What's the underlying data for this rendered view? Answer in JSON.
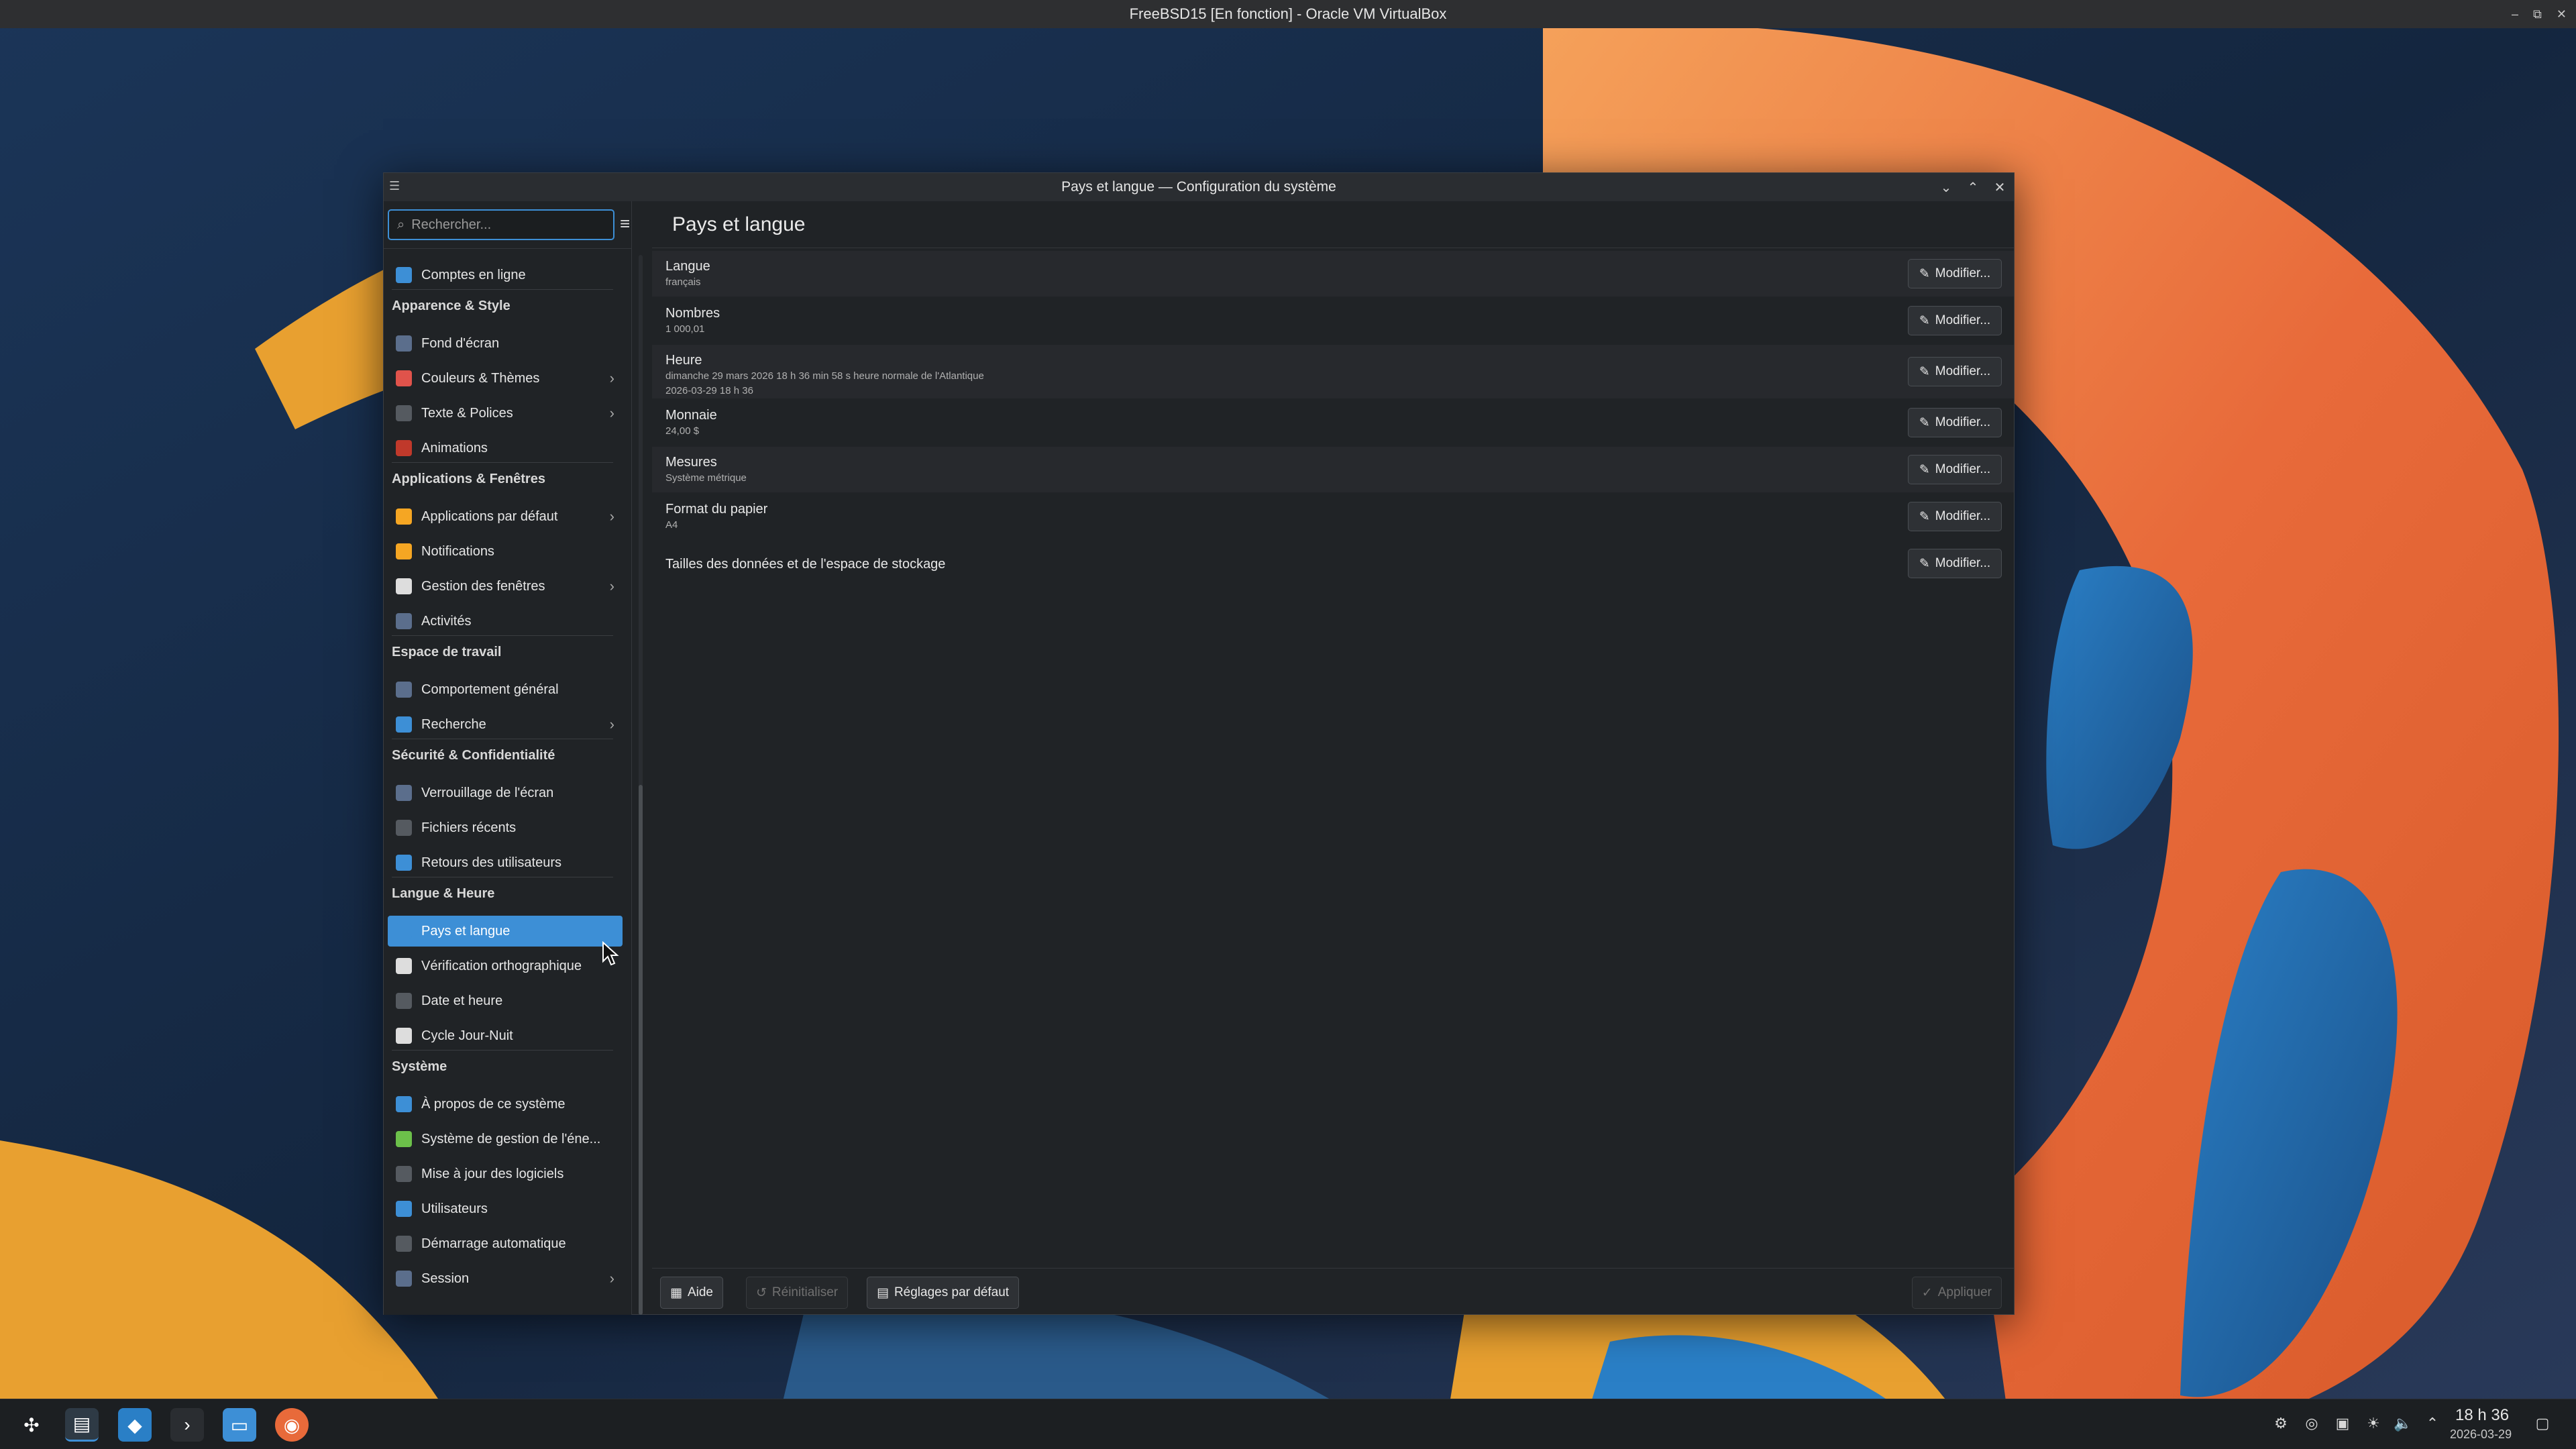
{
  "host_title": "FreeBSD15 [En fonction] - Oracle VM VirtualBox",
  "window": {
    "title": "Pays et langue — Configuration du système"
  },
  "search": {
    "placeholder": "Rechercher..."
  },
  "sidebar": {
    "items": [
      {
        "label": "Comptes en ligne",
        "icon": "globe-icon",
        "color": "#3d8fd6"
      },
      {
        "header": "Apparence & Style"
      },
      {
        "label": "Fond d'écran",
        "icon": "wallpaper-icon",
        "color": "#5b6e8c"
      },
      {
        "label": "Couleurs & Thèmes",
        "icon": "palette-icon",
        "color": "#e0534b",
        "chevron": true
      },
      {
        "label": "Texte & Polices",
        "icon": "font-icon",
        "color": "#555a60",
        "chevron": true
      },
      {
        "label": "Animations",
        "icon": "animation-icon",
        "color": "#c0392b"
      },
      {
        "header": "Applications & Fenêtres"
      },
      {
        "label": "Applications par défaut",
        "icon": "star-icon",
        "color": "#f5a623",
        "chevron": true
      },
      {
        "label": "Notifications",
        "icon": "bell-icon",
        "color": "#f5a623"
      },
      {
        "label": "Gestion des fenêtres",
        "icon": "window-icon",
        "color": "#dddddd",
        "chevron": true
      },
      {
        "label": "Activités",
        "icon": "activities-icon",
        "color": "#5b6e8c"
      },
      {
        "header": "Espace de travail"
      },
      {
        "label": "Comportement général",
        "icon": "behavior-icon",
        "color": "#5b6e8c"
      },
      {
        "label": "Recherche",
        "icon": "search-icon",
        "color": "#3d8fd6",
        "chevron": true
      },
      {
        "header": "Sécurité & Confidentialité"
      },
      {
        "label": "Verrouillage de l'écran",
        "icon": "lock-screen-icon",
        "color": "#5b6e8c"
      },
      {
        "label": "Fichiers récents",
        "icon": "recent-icon",
        "color": "#555a60"
      },
      {
        "label": "Retours des utilisateurs",
        "icon": "feedback-icon",
        "color": "#3d8fd6"
      },
      {
        "header": "Langue & Heure"
      },
      {
        "label": "Pays et langue",
        "icon": "flag-icon",
        "color": "#3d8fd6",
        "active": true
      },
      {
        "label": "Vérification orthographique",
        "icon": "spellcheck-icon",
        "color": "#dddddd"
      },
      {
        "label": "Date et heure",
        "icon": "clock-icon",
        "color": "#555a60"
      },
      {
        "label": "Cycle Jour-Nuit",
        "icon": "day-night-icon",
        "color": "#dddddd"
      },
      {
        "header": "Système"
      },
      {
        "label": "À propos de ce système",
        "icon": "info-icon",
        "color": "#3d8fd6"
      },
      {
        "label": "Système de gestion de l'éne...",
        "icon": "power-icon",
        "color": "#6cc04a"
      },
      {
        "label": "Mise à jour des logiciels",
        "icon": "update-icon",
        "color": "#555a60"
      },
      {
        "label": "Utilisateurs",
        "icon": "users-icon",
        "color": "#3d8fd6"
      },
      {
        "label": "Démarrage automatique",
        "icon": "autostart-icon",
        "color": "#555a60"
      },
      {
        "label": "Session",
        "icon": "session-icon",
        "color": "#5b6e8c",
        "chevron": true
      }
    ]
  },
  "main": {
    "title": "Pays et langue",
    "rows": [
      {
        "label": "Langue",
        "sub": [
          "français"
        ],
        "button": "Modifier..."
      },
      {
        "label": "Nombres",
        "sub": [
          "1 000,01"
        ],
        "button": "Modifier..."
      },
      {
        "label": "Heure",
        "sub": [
          "dimanche 29 mars 2026 18 h 36 min 58 s heure normale de l'Atlantique",
          "2026-03-29 18 h 36"
        ],
        "button": "Modifier..."
      },
      {
        "label": "Monnaie",
        "sub": [
          "24,00 $"
        ],
        "button": "Modifier..."
      },
      {
        "label": "Mesures",
        "sub": [
          "Système métrique"
        ],
        "button": "Modifier..."
      },
      {
        "label": "Format du papier",
        "sub": [
          "A4"
        ],
        "button": "Modifier..."
      },
      {
        "label": "Tailles des données et de l'espace de stockage",
        "sub": [],
        "button": "Modifier..."
      }
    ]
  },
  "footer": {
    "help": "Aide",
    "reset": "Réinitialiser",
    "defaults": "Réglages par défaut",
    "apply": "Appliquer"
  },
  "taskbar": {
    "time": "18 h 36",
    "date": "2026-03-29"
  }
}
